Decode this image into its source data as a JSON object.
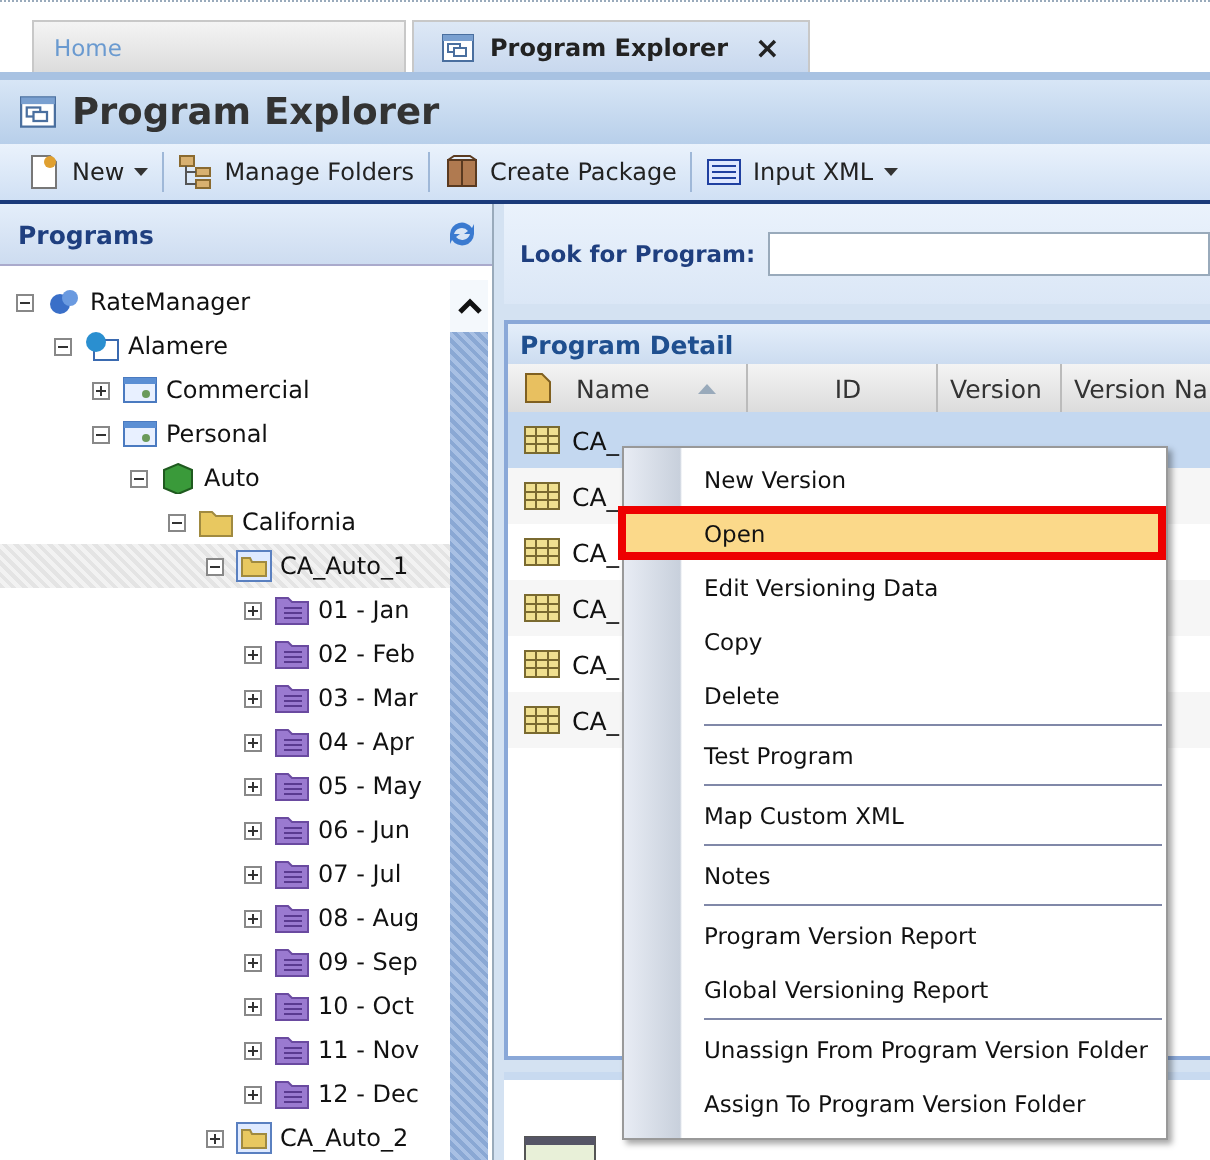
{
  "tabs": [
    {
      "label": "Home",
      "selected": false
    },
    {
      "label": "Program Explorer",
      "selected": true,
      "close": "×"
    }
  ],
  "window": {
    "title": "Program Explorer"
  },
  "toolbar": [
    {
      "label": "New",
      "kind": "new",
      "dropdown": true
    },
    {
      "label": "Manage Folders",
      "kind": "folders",
      "dropdown": false
    },
    {
      "label": "Create Package",
      "kind": "package",
      "dropdown": false
    },
    {
      "label": "Input XML",
      "kind": "xml",
      "dropdown": true
    }
  ],
  "sidebar": {
    "title": "Programs",
    "tree": [
      {
        "label": "RateManager",
        "kind": "server",
        "expanded": true,
        "selected": false,
        "children": [
          {
            "label": "Alamere",
            "kind": "globe",
            "expanded": true,
            "selected": false,
            "children": [
              {
                "label": "Commercial",
                "kind": "category",
                "expanded": false,
                "selected": false
              },
              {
                "label": "Personal",
                "kind": "category",
                "expanded": true,
                "selected": false,
                "children": [
                  {
                    "label": "Auto",
                    "kind": "cube",
                    "expanded": true,
                    "selected": false,
                    "children": [
                      {
                        "label": "California",
                        "kind": "folder",
                        "expanded": true,
                        "selected": false,
                        "children": [
                          {
                            "label": "CA_Auto_1",
                            "kind": "program-folder",
                            "expanded": true,
                            "selected": true,
                            "children": [
                              {
                                "label": "01 - Jan",
                                "kind": "month",
                                "expanded": false,
                                "selected": false
                              },
                              {
                                "label": "02 - Feb",
                                "kind": "month",
                                "expanded": false,
                                "selected": false
                              },
                              {
                                "label": "03 - Mar",
                                "kind": "month",
                                "expanded": false,
                                "selected": false
                              },
                              {
                                "label": "04 - Apr",
                                "kind": "month",
                                "expanded": false,
                                "selected": false
                              },
                              {
                                "label": "05 - May",
                                "kind": "month",
                                "expanded": false,
                                "selected": false
                              },
                              {
                                "label": "06 - Jun",
                                "kind": "month",
                                "expanded": false,
                                "selected": false
                              },
                              {
                                "label": "07 - Jul",
                                "kind": "month",
                                "expanded": false,
                                "selected": false
                              },
                              {
                                "label": "08 - Aug",
                                "kind": "month",
                                "expanded": false,
                                "selected": false
                              },
                              {
                                "label": "09 - Sep",
                                "kind": "month",
                                "expanded": false,
                                "selected": false
                              },
                              {
                                "label": "10 - Oct",
                                "kind": "month",
                                "expanded": false,
                                "selected": false
                              },
                              {
                                "label": "11 - Nov",
                                "kind": "month",
                                "expanded": false,
                                "selected": false
                              },
                              {
                                "label": "12 - Dec",
                                "kind": "month",
                                "expanded": false,
                                "selected": false
                              }
                            ]
                          },
                          {
                            "label": "CA_Auto_2",
                            "kind": "program-folder",
                            "expanded": false,
                            "selected": false
                          }
                        ]
                      }
                    ]
                  }
                ]
              }
            ]
          }
        ]
      }
    ]
  },
  "search": {
    "label": "Look for Program:"
  },
  "detail": {
    "title": "Program Detail",
    "columns": [
      "Name",
      "ID",
      "Version",
      "Version Na"
    ],
    "rows": [
      {
        "name": "CA_",
        "selected": true
      },
      {
        "name": "CA_",
        "selected": false
      },
      {
        "name": "CA_",
        "selected": false
      },
      {
        "name": "CA_",
        "selected": false
      },
      {
        "name": "CA_",
        "selected": false
      },
      {
        "name": "CA_",
        "selected": false
      }
    ]
  },
  "context_menu": [
    {
      "kind": "item",
      "label": "New Version",
      "selected": false
    },
    {
      "kind": "item",
      "label": "Open",
      "selected": true
    },
    {
      "kind": "item",
      "label": "Edit Versioning Data",
      "selected": false
    },
    {
      "kind": "item",
      "label": "Copy",
      "selected": false
    },
    {
      "kind": "item",
      "label": "Delete",
      "selected": false
    },
    {
      "kind": "separator"
    },
    {
      "kind": "item",
      "label": "Test Program",
      "selected": false
    },
    {
      "kind": "separator"
    },
    {
      "kind": "item",
      "label": "Map Custom XML",
      "selected": false
    },
    {
      "kind": "separator"
    },
    {
      "kind": "item",
      "label": "Notes",
      "selected": false
    },
    {
      "kind": "separator"
    },
    {
      "kind": "item",
      "label": "Program Version Report",
      "selected": false
    },
    {
      "kind": "item",
      "label": "Global Versioning Report",
      "selected": false
    },
    {
      "kind": "separator"
    },
    {
      "kind": "item",
      "label": "Unassign From Program Version Folder",
      "selected": false
    },
    {
      "kind": "item",
      "label": "Assign To Program Version Folder",
      "selected": false
    }
  ]
}
